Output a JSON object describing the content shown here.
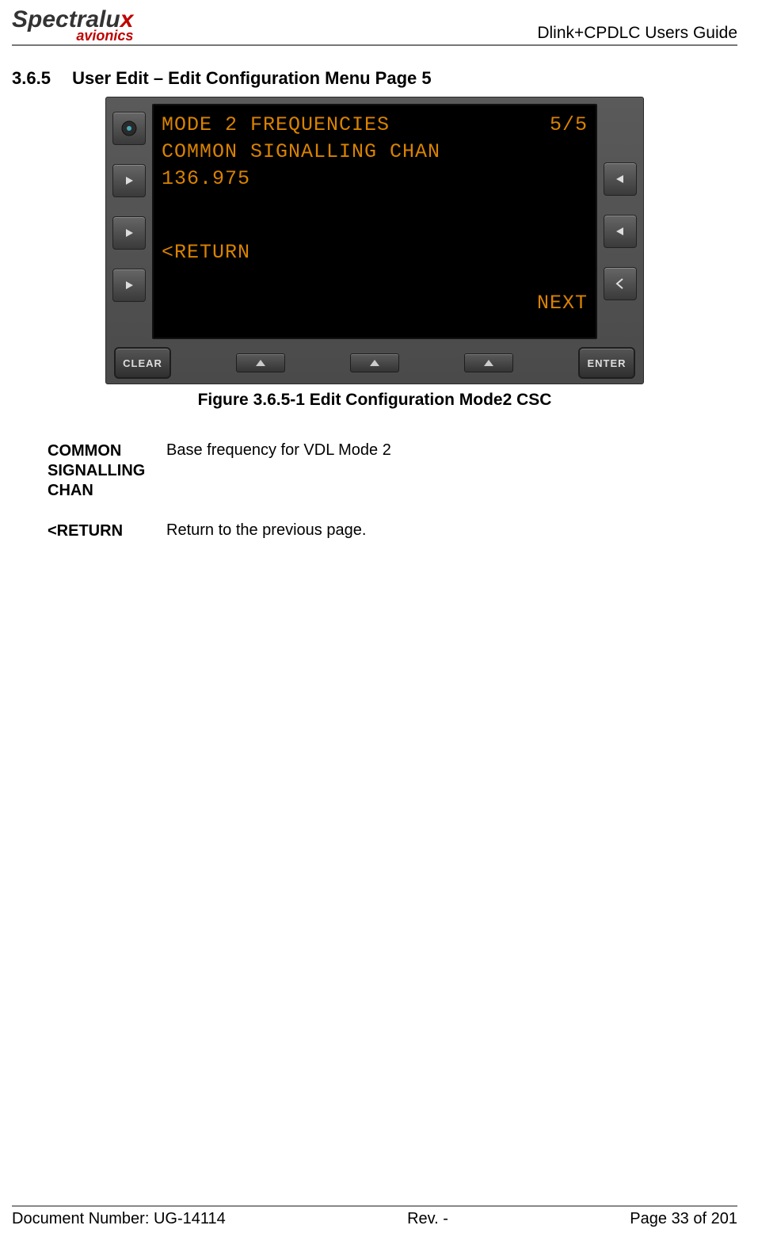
{
  "header": {
    "logo_main": "Spectralu",
    "logo_x": "x",
    "logo_sub": "avionics",
    "guide": "Dlink+CPDLC Users Guide"
  },
  "section": {
    "number": "3.6.5",
    "title": "User Edit – Edit Configuration Menu Page 5"
  },
  "screen": {
    "title": "MODE 2 FREQUENCIES",
    "page": "5/5",
    "line2": "COMMON SIGNALLING CHAN",
    "line3": "136.975",
    "return": "<RETURN",
    "next": "NEXT"
  },
  "buttons": {
    "clear": "CLEAR",
    "enter": "ENTER"
  },
  "figure_caption": "Figure 3.6.5-1 Edit Configuration Mode2 CSC",
  "definitions": [
    {
      "term": "COMMON SIGNALLING CHAN",
      "desc": "Base frequency for VDL Mode 2"
    },
    {
      "term": "<RETURN",
      "desc": "Return to the previous page."
    }
  ],
  "footer": {
    "doc": "Document Number:  UG-14114",
    "rev": "Rev. -",
    "page": "Page 33 of 201"
  }
}
